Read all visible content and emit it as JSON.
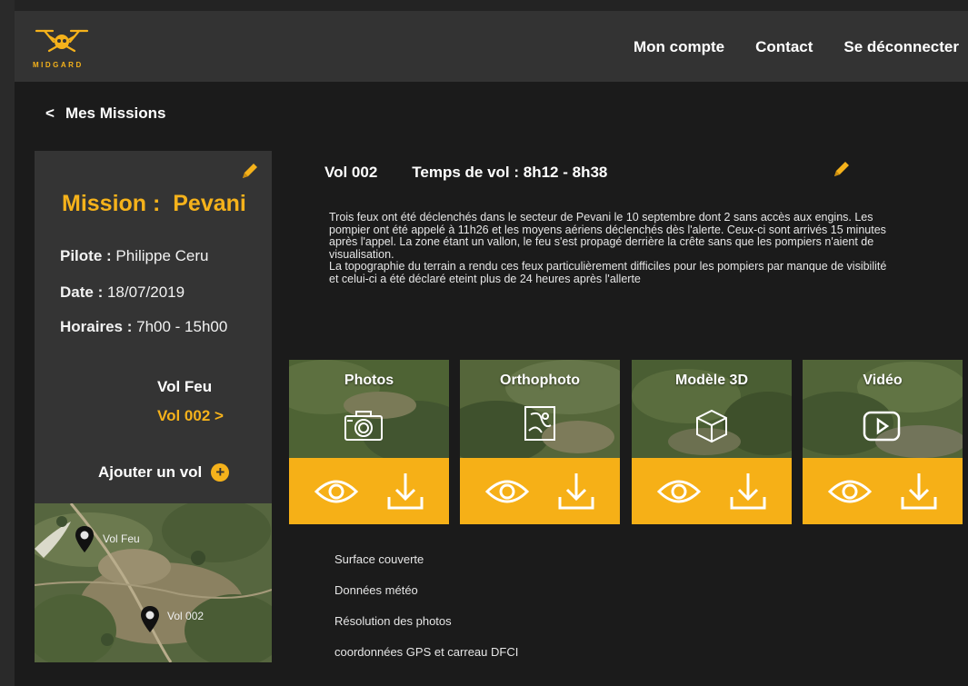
{
  "brand": {
    "name": "MIDGARD",
    "accent": "#f5b21b"
  },
  "nav": {
    "items": [
      "Mon compte",
      "Contact",
      "Se déconnecter"
    ]
  },
  "breadcrumb": {
    "icon": "chevron-left-icon",
    "label": "Mes Missions"
  },
  "mission": {
    "title_prefix": "Mission :",
    "title_name": "Pevani",
    "pilot_label": "Pilote :",
    "pilot_value": "Philippe Ceru",
    "date_label": "Date :",
    "date_value": "18/07/2019",
    "hours_label": "Horaires :",
    "hours_value": "7h00 - 15h00",
    "flights": [
      "Vol Feu",
      "Vol 002 >"
    ],
    "add_flight_label": "Ajouter un vol",
    "add_flight_icon": "plus-circle-icon"
  },
  "map": {
    "markers": [
      "Vol Feu",
      "Vol 002"
    ]
  },
  "flight": {
    "name": "Vol 002",
    "duration": "Temps de vol  : 8h12 - 8h38",
    "description": "Trois feux ont été déclenchés dans le secteur de Pevani le 10 septembre dont 2 sans accès aux engins. Les pompier ont été appelé à 11h26 et les moyens aériens déclenchés dès l'alerte. Ceux-ci sont arrivés 15 minutes après l'appel. La zone étant un vallon, le feu s'est propagé derrière la crête sans que les pompiers n'aient de visualisation.",
    "description_2": "La topographie du terrain a rendu ces feux particulièrement difficiles pour les pompiers par manque de visibilité et celui-ci a été déclaré eteint plus de 24 heures après l'allerte"
  },
  "cards": [
    {
      "title": "Photos",
      "icon": "camera-icon"
    },
    {
      "title": "Orthophoto",
      "icon": "map-icon"
    },
    {
      "title": "Modèle 3D",
      "icon": "cube-icon"
    },
    {
      "title": "Vidéo",
      "icon": "play-icon"
    }
  ],
  "stats": [
    "Surface couverte",
    "Données météo",
    "Résolution des photos",
    "coordonnées GPS et carreau DFCI"
  ]
}
